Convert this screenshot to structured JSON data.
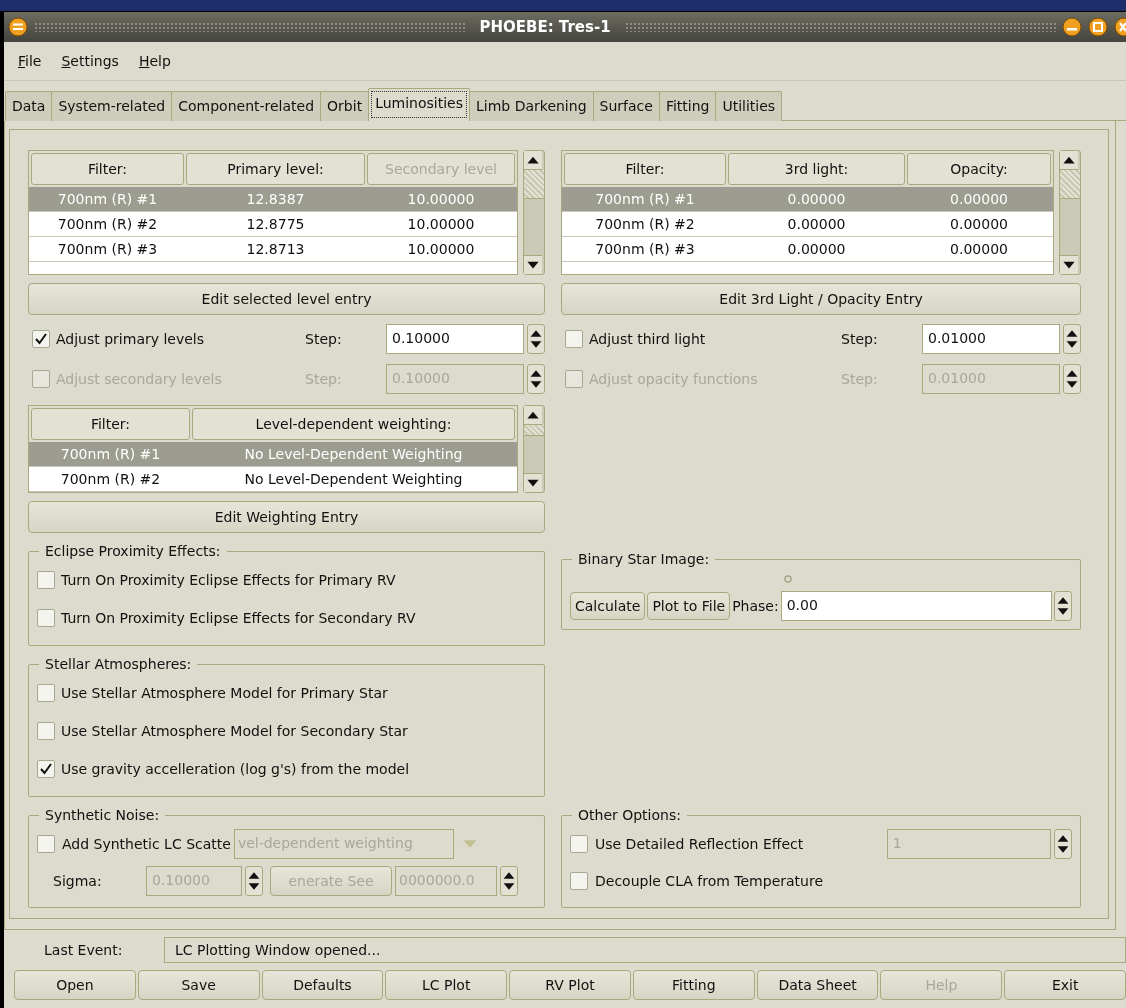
{
  "window": {
    "title": "PHOEBE: Tres-1"
  },
  "menu": [
    {
      "label": "File"
    },
    {
      "label": "Settings"
    },
    {
      "label": "Help"
    }
  ],
  "tabs": [
    {
      "label": "Data",
      "selected": false
    },
    {
      "label": "System-related",
      "selected": false
    },
    {
      "label": "Component-related",
      "selected": false
    },
    {
      "label": "Orbit",
      "selected": false
    },
    {
      "label": "Luminosities",
      "selected": true
    },
    {
      "label": "Limb Darkening",
      "selected": false
    },
    {
      "label": "Surface",
      "selected": false
    },
    {
      "label": "Fitting",
      "selected": false
    },
    {
      "label": "Utilities",
      "selected": false
    }
  ],
  "level_table": {
    "columns": [
      {
        "label": "Filter:",
        "disabled": false
      },
      {
        "label": "Primary level:",
        "disabled": false
      },
      {
        "label": "Secondary level",
        "disabled": true
      }
    ],
    "rows": [
      {
        "cells": [
          "700nm (R) #1",
          "12.8387",
          "10.00000"
        ],
        "selected": true
      },
      {
        "cells": [
          "700nm (R) #2",
          "12.8775",
          "10.00000"
        ],
        "selected": false
      },
      {
        "cells": [
          "700nm (R) #3",
          "12.8713",
          "10.00000"
        ],
        "selected": false
      }
    ]
  },
  "level_button": "Edit selected level entry",
  "level_adjust": [
    {
      "label": "Adjust primary levels",
      "checked": true,
      "disabled": false,
      "step_label": "Step:",
      "step": "0.10000"
    },
    {
      "label": "Adjust secondary levels",
      "checked": false,
      "disabled": true,
      "step_label": "Step:",
      "step": "0.10000"
    }
  ],
  "light_table": {
    "columns": [
      {
        "label": "Filter:",
        "disabled": false
      },
      {
        "label": "3rd light:",
        "disabled": false
      },
      {
        "label": "Opacity:",
        "disabled": false
      }
    ],
    "rows": [
      {
        "cells": [
          "700nm (R) #1",
          "0.00000",
          "0.00000"
        ],
        "selected": true
      },
      {
        "cells": [
          "700nm (R) #2",
          "0.00000",
          "0.00000"
        ],
        "selected": false
      },
      {
        "cells": [
          "700nm (R) #3",
          "0.00000",
          "0.00000"
        ],
        "selected": false
      }
    ]
  },
  "light_button": "Edit 3rd Light / Opacity Entry",
  "light_adjust": [
    {
      "label": "Adjust third light",
      "checked": false,
      "disabled": false,
      "step_label": "Step:",
      "step": "0.01000"
    },
    {
      "label": "Adjust opacity functions",
      "checked": false,
      "disabled": true,
      "step_label": "Step:",
      "step": "0.01000"
    }
  ],
  "weighting_table": {
    "columns": [
      {
        "label": "Filter:",
        "disabled": false
      },
      {
        "label": "Level-dependent weighting:",
        "disabled": false
      }
    ],
    "rows": [
      {
        "cells": [
          "700nm (R) #1",
          "No Level-Dependent Weighting"
        ],
        "selected": true
      },
      {
        "cells": [
          "700nm (R) #2",
          "No Level-Dependent Weighting"
        ],
        "selected": false
      }
    ]
  },
  "weighting_button": "Edit Weighting Entry",
  "eclipse": {
    "title": "Eclipse Proximity Effects:",
    "options": [
      {
        "label": "Turn On Proximity Eclipse Effects for Primary RV",
        "checked": false
      },
      {
        "label": "Turn On Proximity Eclipse Effects for Secondary RV",
        "checked": false
      }
    ]
  },
  "atmospheres": {
    "title": "Stellar Atmospheres:",
    "options": [
      {
        "label": "Use Stellar Atmosphere Model for Primary Star",
        "checked": false
      },
      {
        "label": "Use Stellar Atmosphere Model for Secondary Star",
        "checked": false
      },
      {
        "label": "Use gravity accelleration (log g's) from the model",
        "checked": true
      }
    ]
  },
  "noise": {
    "title": "Synthetic Noise:",
    "scatter": {
      "label": "Add Synthetic LC Scatte",
      "checked": false
    },
    "weighting_combo": {
      "value": "vel-dependent weighting",
      "disabled": true
    },
    "sigma_label": "Sigma:",
    "sigma": {
      "value": "0.10000",
      "disabled": true
    },
    "seed_button": {
      "label": "enerate See",
      "disabled": true
    },
    "seed": {
      "value": "0000000.0",
      "disabled": true
    }
  },
  "binary_image": {
    "title": "Binary Star Image:",
    "buttons": [
      "Calculate",
      "Plot to File"
    ],
    "phase_label": "Phase:",
    "phase": "0.00"
  },
  "other": {
    "title": "Other Options:",
    "reflection": {
      "label": "Use Detailed Reflection Effect",
      "checked": false,
      "value": "1",
      "value_disabled": true
    },
    "decouple": {
      "label": "Decouple CLA from Temperature",
      "checked": false
    }
  },
  "status": {
    "label": "Last Event:",
    "value": "LC Plotting Window opened..."
  },
  "buttons": [
    {
      "label": "Open",
      "disabled": false
    },
    {
      "label": "Save",
      "disabled": false
    },
    {
      "label": "Defaults",
      "disabled": false
    },
    {
      "label": "LC Plot",
      "disabled": false
    },
    {
      "label": "RV Plot",
      "disabled": false
    },
    {
      "label": "Fitting",
      "disabled": false
    },
    {
      "label": "Data Sheet",
      "disabled": false
    },
    {
      "label": "Help",
      "disabled": true
    },
    {
      "label": "Exit",
      "disabled": false
    }
  ]
}
